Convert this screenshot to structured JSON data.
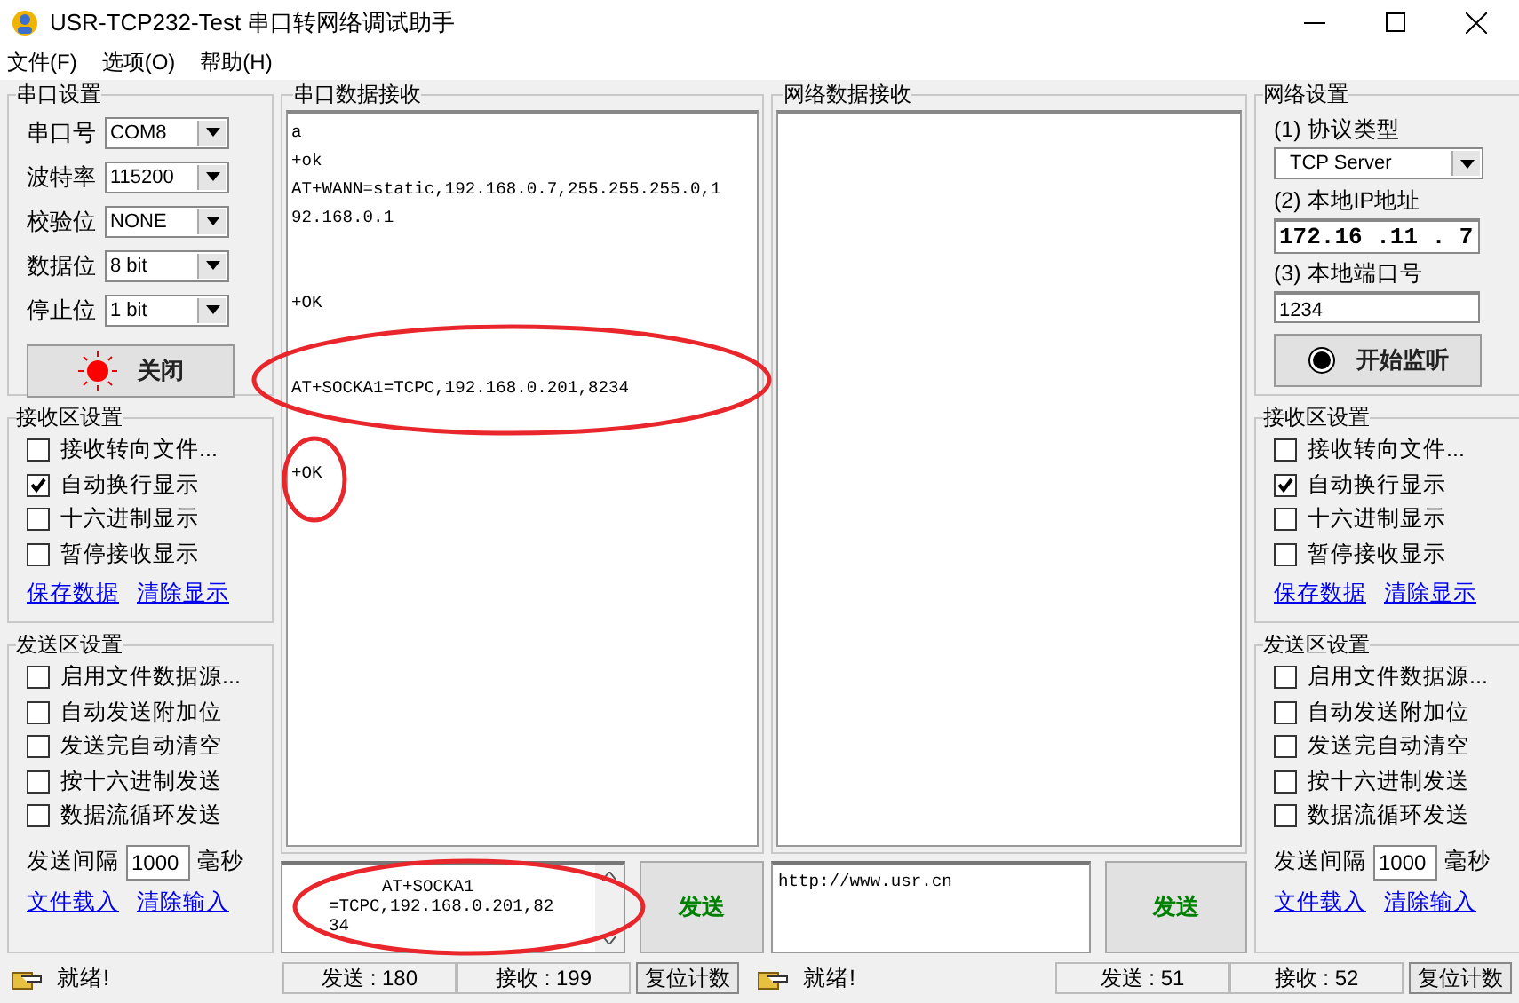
{
  "window": {
    "title": "USR-TCP232-Test 串口转网络调试助手"
  },
  "menu": [
    {
      "label": "文件(F)"
    },
    {
      "label": "选项(O)"
    },
    {
      "label": "帮助(H)"
    }
  ],
  "serial_settings": {
    "title": "串口设置",
    "fields": [
      {
        "label": "串口号",
        "value": "COM8"
      },
      {
        "label": "波特率",
        "value": "115200"
      },
      {
        "label": "校验位",
        "value": "NONE"
      },
      {
        "label": "数据位",
        "value": "8 bit"
      },
      {
        "label": "停止位",
        "value": "1 bit"
      }
    ],
    "button": {
      "label": "关闭",
      "on": true
    }
  },
  "left_receive_settings": {
    "title": "接收区设置",
    "options": [
      {
        "label": "接收转向文件...",
        "checked": false
      },
      {
        "label": "自动换行显示",
        "checked": true
      },
      {
        "label": "十六进制显示",
        "checked": false
      },
      {
        "label": "暂停接收显示",
        "checked": false
      }
    ],
    "links": [
      "保存数据",
      "清除显示"
    ]
  },
  "left_send_settings": {
    "title": "发送区设置",
    "options": [
      {
        "label": "启用文件数据源...",
        "checked": false
      },
      {
        "label": "自动发送附加位",
        "checked": false
      },
      {
        "label": "发送完自动清空",
        "checked": false
      },
      {
        "label": "按十六进制发送",
        "checked": false
      },
      {
        "label": "数据流循环发送",
        "checked": false
      }
    ],
    "interval_label": "发送间隔",
    "interval": "1000",
    "unit": "毫秒",
    "links": [
      "文件载入",
      "清除输入"
    ]
  },
  "serial_receive": {
    "title": "串口数据接收",
    "lines": [
      {
        "kind": "text",
        "text": "a"
      },
      {
        "kind": "text",
        "text": "+ok"
      },
      {
        "kind": "text",
        "text": "AT+WANN=static,192.168.0.7,255.255.255.0,1"
      },
      {
        "kind": "text",
        "text": "92.168.0.1"
      },
      {
        "kind": "blank"
      },
      {
        "kind": "blank"
      },
      {
        "kind": "text",
        "text": "+OK"
      },
      {
        "kind": "blank"
      },
      {
        "kind": "blank"
      },
      {
        "kind": "text",
        "text": "AT+SOCKA1=TCPC,192.168.0.201,8234"
      },
      {
        "kind": "blank"
      },
      {
        "kind": "blank"
      },
      {
        "kind": "text",
        "text": "+OK"
      }
    ]
  },
  "serial_send": {
    "text": "AT+SOCKA1\n=TCPC,192.168.0.201,82\n34",
    "button": "发送"
  },
  "net_receive": {
    "title": "网络数据接收"
  },
  "net_send": {
    "text": "http://www.usr.cn",
    "button": "发送"
  },
  "net_settings": {
    "title": "网络设置",
    "protocol_label": "(1) 协议类型",
    "protocol": "TCP Server",
    "ip_label": "(2) 本地IP地址",
    "ip": "172.16 .11 . 7",
    "port_label": "(3) 本地端口号",
    "port": "1234",
    "button": {
      "label": "开始监听",
      "on": false
    }
  },
  "right_receive_settings": {
    "title": "接收区设置",
    "options": [
      {
        "label": "接收转向文件...",
        "checked": false
      },
      {
        "label": "自动换行显示",
        "checked": true
      },
      {
        "label": "十六进制显示",
        "checked": false
      },
      {
        "label": "暂停接收显示",
        "checked": false
      }
    ],
    "links": [
      "保存数据",
      "清除显示"
    ]
  },
  "right_send_settings": {
    "title": "发送区设置",
    "options": [
      {
        "label": "启用文件数据源...",
        "checked": false
      },
      {
        "label": "自动发送附加位",
        "checked": false
      },
      {
        "label": "发送完自动清空",
        "checked": false
      },
      {
        "label": "按十六进制发送",
        "checked": false
      },
      {
        "label": "数据流循环发送",
        "checked": false
      }
    ],
    "interval_label": "发送间隔",
    "interval": "1000",
    "unit": "毫秒",
    "links": [
      "文件载入",
      "清除输入"
    ]
  },
  "status_bars": [
    {
      "status": "就绪!",
      "sent": "发送 : 180",
      "received": "接收 : 199",
      "reset": "复位计数"
    },
    {
      "status": "就绪!",
      "sent": "发送 : 51",
      "received": "接收 : 52",
      "reset": "复位计数"
    }
  ]
}
